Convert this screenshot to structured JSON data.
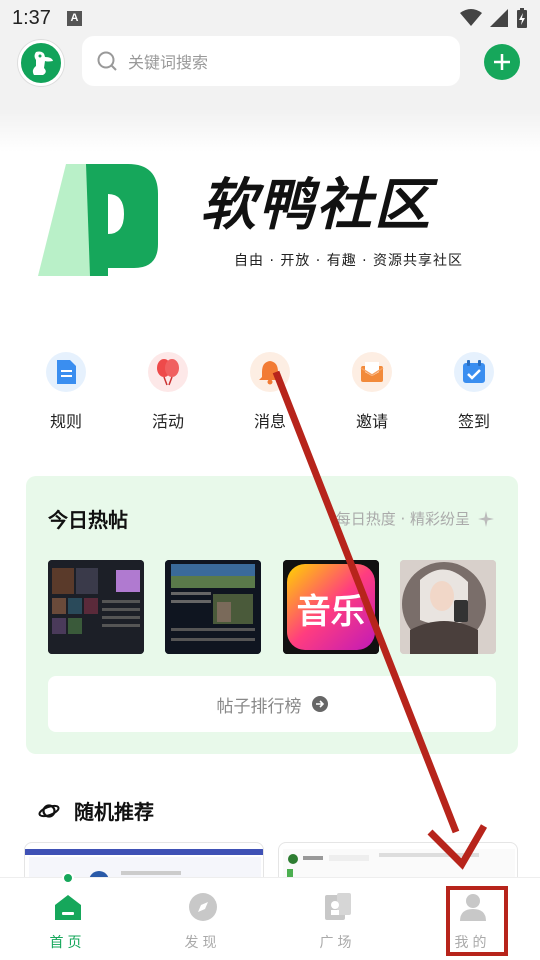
{
  "status_bar": {
    "time": "1:37"
  },
  "search": {
    "placeholder": "关键词搜索"
  },
  "banner": {
    "title": "软鸭社区",
    "subtitle": "自由 · 开放 · 有趣 · 资源共享社区"
  },
  "quick_actions": [
    {
      "label": "规则",
      "icon": "document-icon",
      "color": "#3a8ef0"
    },
    {
      "label": "活动",
      "icon": "balloon-icon",
      "color": "#ee4a4a"
    },
    {
      "label": "消息",
      "icon": "bell-icon",
      "color": "#f27b34"
    },
    {
      "label": "邀请",
      "icon": "envelope-icon",
      "color": "#f28a3a"
    },
    {
      "label": "签到",
      "icon": "calendar-check-icon",
      "color": "#3a8ef0"
    }
  ],
  "hot_posts": {
    "title": "今日热帖",
    "subtitle": "每日热度 · 精彩纷呈",
    "thumb_music_text": "音乐",
    "ranking_label": "帖子排行榜"
  },
  "random": {
    "title": "随机推荐"
  },
  "bottom_nav": [
    {
      "label": "首页",
      "icon": "home-icon",
      "active": true
    },
    {
      "label": "发现",
      "icon": "compass-icon",
      "active": false
    },
    {
      "label": "广场",
      "icon": "square-icon",
      "active": false
    },
    {
      "label": "我的",
      "icon": "user-icon",
      "active": false
    }
  ],
  "colors": {
    "accent": "#16a75b",
    "annotation": "#b7241b",
    "hot_card_bg": "#e8f9ea"
  }
}
